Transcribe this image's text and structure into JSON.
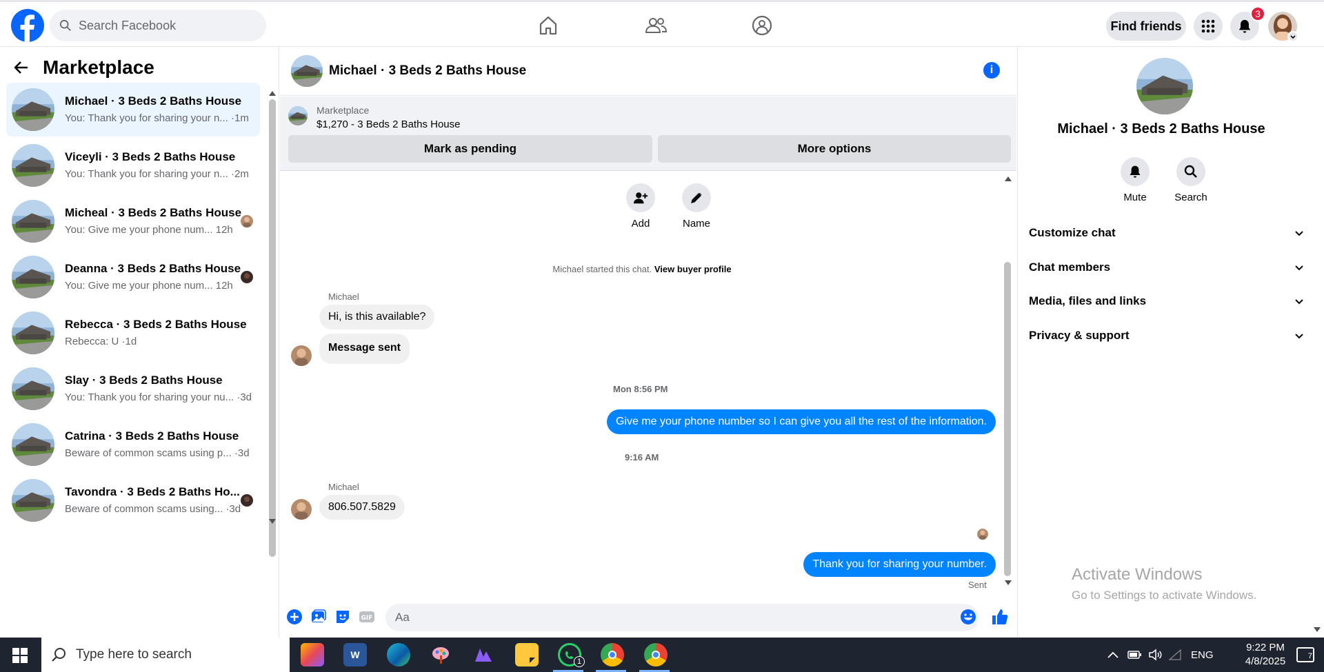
{
  "topbar": {
    "search_placeholder": "Search Facebook",
    "find_friends_label": "Find friends",
    "notifications_count": "3"
  },
  "sidebar": {
    "title": "Marketplace",
    "conversations": [
      {
        "title": "Michael · 3 Beds 2 Baths House",
        "preview": "You: Thank you for sharing your n... ·1m",
        "active": true
      },
      {
        "title": "Viceyli · 3 Beds 2 Baths House",
        "preview": "You: Thank you for sharing your n... ·2m"
      },
      {
        "title": "Micheal · 3 Beds 2 Baths House",
        "preview": "You: Give me your phone num...  12h"
      },
      {
        "title": "Deanna · 3 Beds 2 Baths House",
        "preview": "You: Give me your phone num...  12h"
      },
      {
        "title": "Rebecca · 3 Beds 2 Baths House",
        "preview": "Rebecca: U ·1d"
      },
      {
        "title": "Slay · 3 Beds 2 Baths House",
        "preview": "You: Thank you for sharing your nu... ·3d"
      },
      {
        "title": "Catrina · 3 Beds 2 Baths House",
        "preview": "Beware of common scams using p... ·3d"
      },
      {
        "title": "Tavondra · 3 Beds 2 Baths Ho...",
        "preview": "Beware of common scams using... ·3d"
      }
    ]
  },
  "chat": {
    "title": "Michael · 3 Beds 2 Baths House",
    "listing": {
      "label": "Marketplace",
      "price_title": "$1,270 - 3 Beds 2 Baths House",
      "pending_button": "Mark as pending",
      "more_button": "More options"
    },
    "actions": {
      "add": "Add",
      "name": "Name"
    },
    "system_text": "Michael started this chat.",
    "system_link": "View buyer profile",
    "messages": {
      "sender1": "Michael",
      "m1": "Hi, is this available?",
      "m2": "Message sent",
      "ts1": "Mon 8:56 PM",
      "m3": "Give me your phone number so I can give you all the rest of the information.",
      "ts2": "9:16 AM",
      "sender2": "Michael",
      "m4": "806.507.5829",
      "m5": "Thank you for sharing your number.",
      "status": "Sent"
    },
    "composer_placeholder": "Aa"
  },
  "details": {
    "title": "Michael · 3 Beds 2 Baths House",
    "mute_label": "Mute",
    "search_label": "Search",
    "sections": [
      "Customize chat",
      "Chat members",
      "Media, files and links",
      "Privacy & support"
    ]
  },
  "watermark": {
    "line1": "Activate Windows",
    "line2": "Go to Settings to activate Windows."
  },
  "taskbar": {
    "search_placeholder": "Type here to search",
    "whatsapp_badge": "1",
    "language": "ENG",
    "time": "9:22 PM",
    "date": "4/8/2025",
    "notif_count": "7"
  },
  "colors": {
    "brand": "#0866ff",
    "outgoing_bubble": "#0084ff",
    "badge": "#e41e3f"
  }
}
